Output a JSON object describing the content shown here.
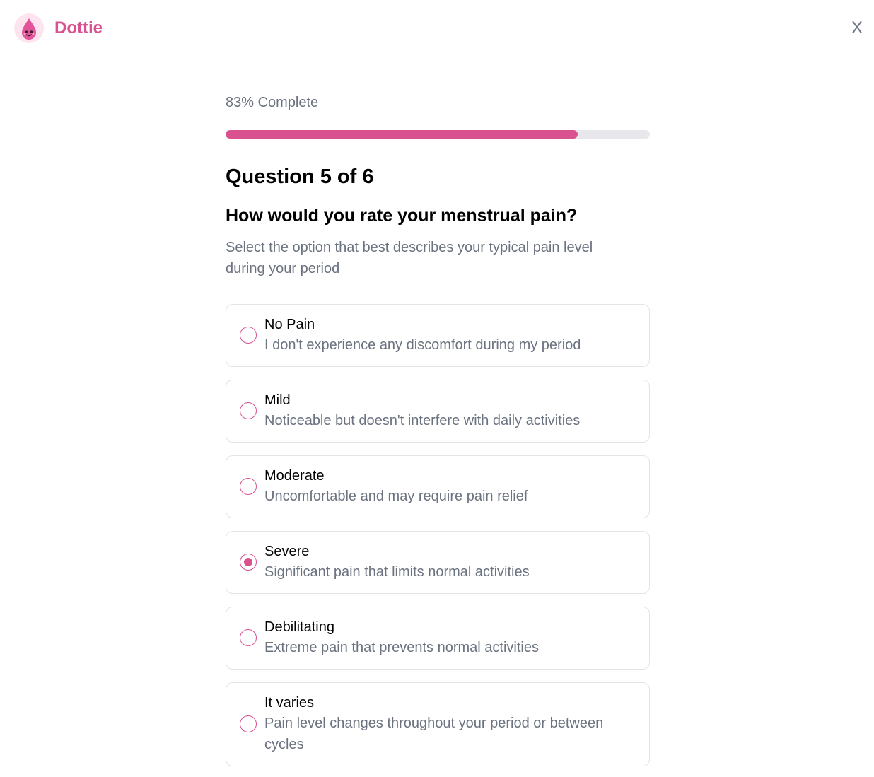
{
  "header": {
    "brand": "Dottie",
    "close_label": "X",
    "accent_color": "#d9518f"
  },
  "progress": {
    "label": "83% Complete",
    "percent": 83
  },
  "question": {
    "number_label": "Question 5 of 6",
    "title": "How would you rate your menstrual pain?",
    "subtitle": "Select the option that best describes your typical pain level during your period"
  },
  "options": [
    {
      "title": "No Pain",
      "description": "I don't experience any discomfort during my period",
      "selected": false
    },
    {
      "title": "Mild",
      "description": "Noticeable but doesn't interfere with daily activities",
      "selected": false
    },
    {
      "title": "Moderate",
      "description": "Uncomfortable and may require pain relief",
      "selected": false
    },
    {
      "title": "Severe",
      "description": "Significant pain that limits normal activities",
      "selected": true
    },
    {
      "title": "Debilitating",
      "description": "Extreme pain that prevents normal activities",
      "selected": false
    },
    {
      "title": "It varies",
      "description": "Pain level changes throughout your period or between cycles",
      "selected": false
    }
  ]
}
